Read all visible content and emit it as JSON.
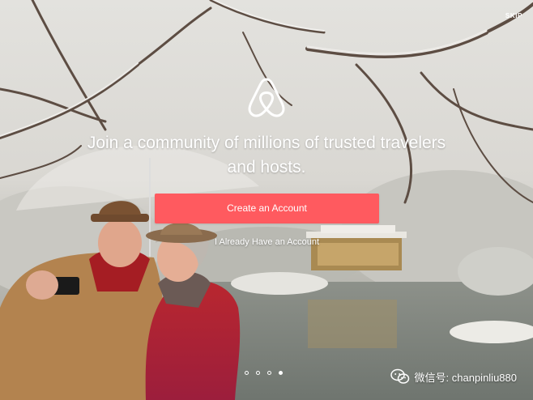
{
  "header": {
    "skip_label": "SKIP"
  },
  "hero": {
    "logo_icon": "airbnb-belo-icon",
    "headline": "Join a community of millions of trusted travelers and hosts."
  },
  "actions": {
    "create_account_label": "Create an Account",
    "login_label": "I Already Have an Account"
  },
  "pager": {
    "total": 4,
    "active_index": 3
  },
  "watermark": {
    "icon": "wechat-icon",
    "text": "微信号: chanpinliu880"
  },
  "colors": {
    "brand": "#ff5a5f",
    "text_on_image": "#ffffff"
  }
}
